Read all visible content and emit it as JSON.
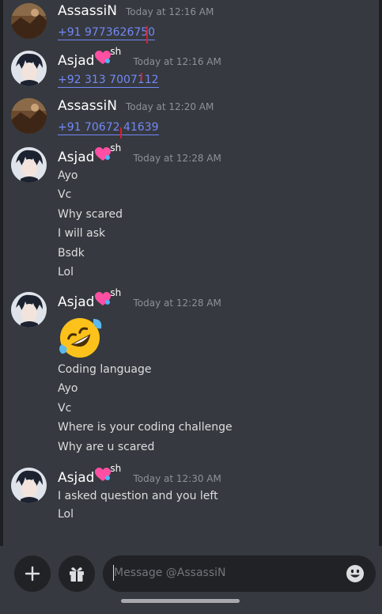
{
  "colors": {
    "background": "#36393f",
    "link": "#7289f7",
    "timestamp": "#8e9297",
    "input_bg": "#202225",
    "redaction_mark": "#e01b2b"
  },
  "messages": [
    {
      "author": "AssassiN",
      "time": "Today at 12:16 AM",
      "avatar": "landscape-avatar",
      "lines": [
        {
          "text": "+91 9773626750",
          "kind": "link"
        }
      ]
    },
    {
      "author": "Asjad",
      "author_suffix": "sh",
      "author_emoji": "heart-emoji",
      "time": "Today at 12:16 AM",
      "avatar": "anime-avatar",
      "lines": [
        {
          "text": "+92 313 7007112",
          "kind": "link"
        }
      ]
    },
    {
      "author": "AssassiN",
      "time": "Today at 12:20 AM",
      "avatar": "landscape-avatar",
      "lines": [
        {
          "text": "+91 70672 41639",
          "kind": "link"
        }
      ]
    },
    {
      "author": "Asjad",
      "author_suffix": "sh",
      "author_emoji": "heart-emoji",
      "time": "Today at 12:28 AM",
      "avatar": "anime-avatar",
      "lines": [
        {
          "text": "Ayo"
        },
        {
          "text": "Vc"
        },
        {
          "text": "Why scared"
        },
        {
          "text": "I will ask"
        },
        {
          "text": "Bsdk"
        },
        {
          "text": "Lol"
        }
      ]
    },
    {
      "author": "Asjad",
      "author_suffix": "sh",
      "author_emoji": "heart-emoji",
      "time": "Today at 12:28 AM",
      "avatar": "anime-avatar",
      "emoji": "rolling-on-floor-laughing-emoji",
      "lines": [
        {
          "text": "Coding language"
        },
        {
          "text": "Ayo"
        },
        {
          "text": "Vc"
        },
        {
          "text": "Where is your coding challenge"
        },
        {
          "text": "Why are u scared"
        }
      ]
    },
    {
      "author": "Asjad",
      "author_suffix": "sh",
      "author_emoji": "heart-emoji",
      "time": "Today at 12:30 AM",
      "avatar": "anime-avatar",
      "lines": [
        {
          "text": "I asked question and you left"
        },
        {
          "text": "Lol"
        }
      ]
    }
  ],
  "composer": {
    "placeholder": "Message @AssassiN",
    "add_icon": "plus-icon",
    "gift_icon": "gift-icon",
    "emoji_icon": "smiley-icon"
  }
}
